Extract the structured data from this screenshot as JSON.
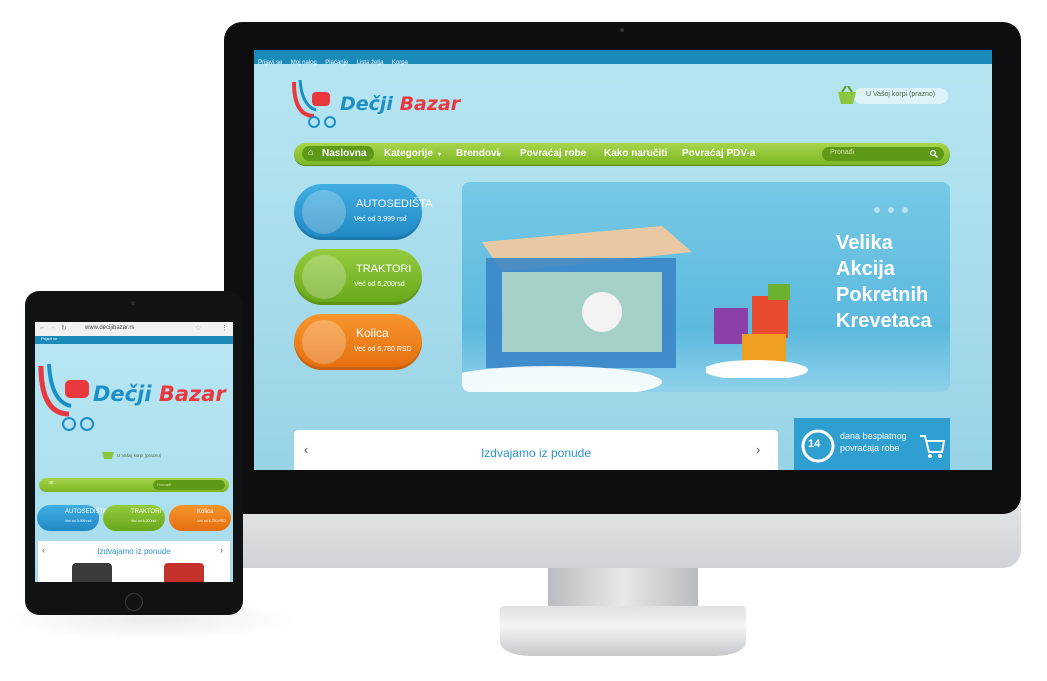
{
  "desktop": {
    "topbar_links": [
      "Prijavi se",
      "Moj nalog",
      "Plaćanje",
      "Lista želja",
      "Korpa"
    ],
    "logo": {
      "part1": "Dečji",
      "part2": "Bazar"
    },
    "cart": {
      "label": "U Vašoj korpi (prazno)"
    },
    "nav": {
      "items": [
        "Naslovna",
        "Kategorije",
        "Brendovi",
        "Povraćaj robe",
        "Kako naručiti",
        "Povraćaj PDV-a"
      ],
      "search_placeholder": "Pronađi"
    },
    "promos": [
      {
        "title": "AUTOSEDIŠTA",
        "subtitle": "Već od 3.999 rsd",
        "color": "#2c9ad3"
      },
      {
        "title": "TRAKTORI",
        "subtitle": "Već od 6,200rsd",
        "color": "#7bbb24"
      },
      {
        "title": "Kolica",
        "subtitle": "Već od 6,780 RSD",
        "color": "#f08019"
      }
    ],
    "slider": {
      "lines": [
        "Velika",
        "Akcija",
        "Pokretnih",
        "Krevetaca"
      ]
    },
    "featured": {
      "title": "Izdvajamo iz ponude"
    },
    "return_banner": {
      "number": "14",
      "line1": "dana besplatnog",
      "line2": "povraćaja robe"
    }
  },
  "tablet": {
    "url": "www.decijibazar.rs",
    "topbar_label": "Prijavi se",
    "logo": {
      "part1": "Dečji",
      "part2": "Bazar"
    },
    "cart_label": "U Vašoj korpi (prazno)",
    "search_placeholder": "Pronađi",
    "promos": [
      {
        "title": "AUTOSEDIŠTA",
        "subtitle": "Već od 3.999 rsd",
        "color": "#2c9ad3"
      },
      {
        "title": "TRAKTORI",
        "subtitle": "Već od 6,200rsd",
        "color": "#7bbb24"
      },
      {
        "title": "Kolica",
        "subtitle": "Već od 6,780 RSD",
        "color": "#f08019"
      }
    ],
    "featured_title": "Izdvajamo iz ponude"
  }
}
